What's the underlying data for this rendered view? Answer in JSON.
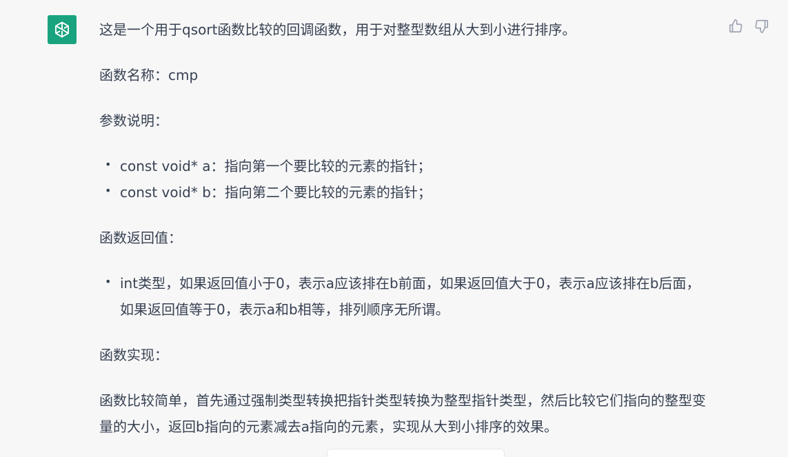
{
  "message": {
    "intro": "这是一个用于qsort函数比较的回调函数，用于对整型数组从大到小进行排序。",
    "function_name_line": "函数名称：cmp",
    "params_heading": "参数说明：",
    "params": [
      "const void* a：指向第一个要比较的元素的指针；",
      "const void* b：指向第二个要比较的元素的指针；"
    ],
    "return_heading": "函数返回值：",
    "returns": [
      "int类型，如果返回值小于0，表示a应该排在b前面，如果返回值大于0，表示a应该排在b后面，如果返回值等于0，表示a和b相等，排列顺序无所谓。"
    ],
    "impl_heading": "函数实现：",
    "impl_text": "函数比较简单，首先通过强制类型转换把指针类型转换为整型指针类型，然后比较它们指向的整型变量的大小，返回b指向的元素减去a指向的元素，实现从大到小排序的效果。"
  },
  "avatar": {
    "icon": "openai-logo-icon",
    "color": "#19a37f"
  },
  "feedback": {
    "like_icon": "thumbs-up-icon",
    "dislike_icon": "thumbs-down-icon"
  }
}
